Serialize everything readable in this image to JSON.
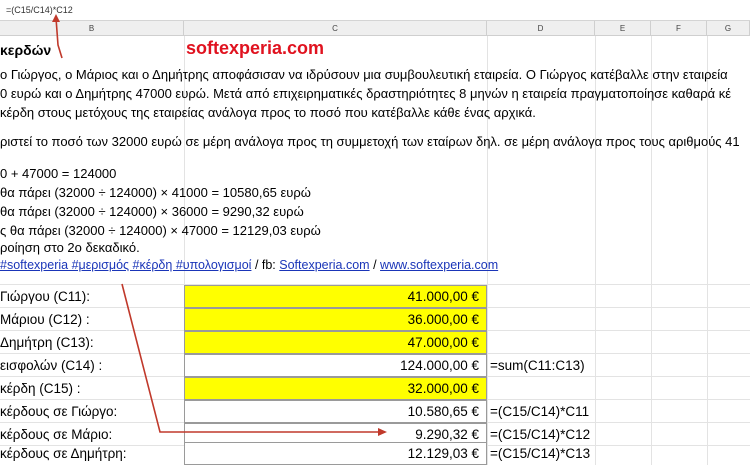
{
  "formula_bar": {
    "content": "=(C15/C14)*C12"
  },
  "columns": [
    "B",
    "C",
    "D",
    "E",
    "F",
    "G"
  ],
  "header": {
    "title": "κερδών",
    "brand": "softexperia.com"
  },
  "paragraphs": [
    "ο Γιώργος, ο Μάριος και ο Δημήτρης αποφάσισαν να ιδρύσουν μια συμβουλευτική εταιρεία. Ο Γιώργος κατέβαλλε στην εταιρεία",
    "0 ευρώ και ο Δημήτρης 47000 ευρώ. Μετά από επιχειρηματικές δραστηριότητες 8 μηνών η εταιρεία πραγματοποίησε καθαρά κέ",
    "κέρδη στους μετόχους της εταιρείας ανάλογα προς το ποσό που κατέβαλλε κάθε ένας αρχικά.",
    "ριστεί το ποσό των 32000 ευρώ σε μέρη ανάλογα προς τη συμμετοχή των εταίρων δηλ. σε μέρη ανάλογα προς τους αριθμούς 41",
    "0 + 47000 = 124000",
    "θα πάρει (32000 ÷ 124000) × 41000 = 10580,65 ευρώ",
    "θα πάρει (32000 ÷ 124000) × 36000 = 9290,32 ευρώ",
    "ς θα πάρει (32000 ÷ 124000) × 47000 = 12129,03 ευρώ",
    "ροίηση στο 2ο δεκαδικό."
  ],
  "tags": {
    "hashtags": "#softexperia #μερισμός #κέρδη #υπολογισμοί",
    "sep1": "/ fb:",
    "fb": "Softexperia.com",
    "sep2": "/",
    "site": "www.softexperia.com"
  },
  "rows": [
    {
      "label": "Γιώργου (C11):",
      "value": "41.000,00 €",
      "formula": ""
    },
    {
      "label": "Μάριου (C12) :",
      "value": "36.000,00 €",
      "formula": ""
    },
    {
      "label": "Δημήτρη (C13):",
      "value": "47.000,00 €",
      "formula": ""
    },
    {
      "label": "εισφολών (C14) :",
      "value": "124.000,00 €",
      "formula": "=sum(C11:C13)"
    },
    {
      "label": "κέρδη (C15) :",
      "value": "32.000,00 €",
      "formula": ""
    },
    {
      "label": "κέρδους σε Γιώργο:",
      "value": "10.580,65 €",
      "formula": "=(C15/C14)*C11"
    },
    {
      "label": "κέρδους σε Μάριο:",
      "value": "9.290,32 €",
      "formula": "=(C15/C14)*C12"
    },
    {
      "label": "κέρδους σε Δημήτρη:",
      "value": "12.129,03 €",
      "formula": "=(C15/C14)*C13"
    }
  ],
  "colors": {
    "highlight": "#ffff00",
    "brand": "#e0121f",
    "link": "#1a35b8",
    "arrow": "#c0392b"
  }
}
